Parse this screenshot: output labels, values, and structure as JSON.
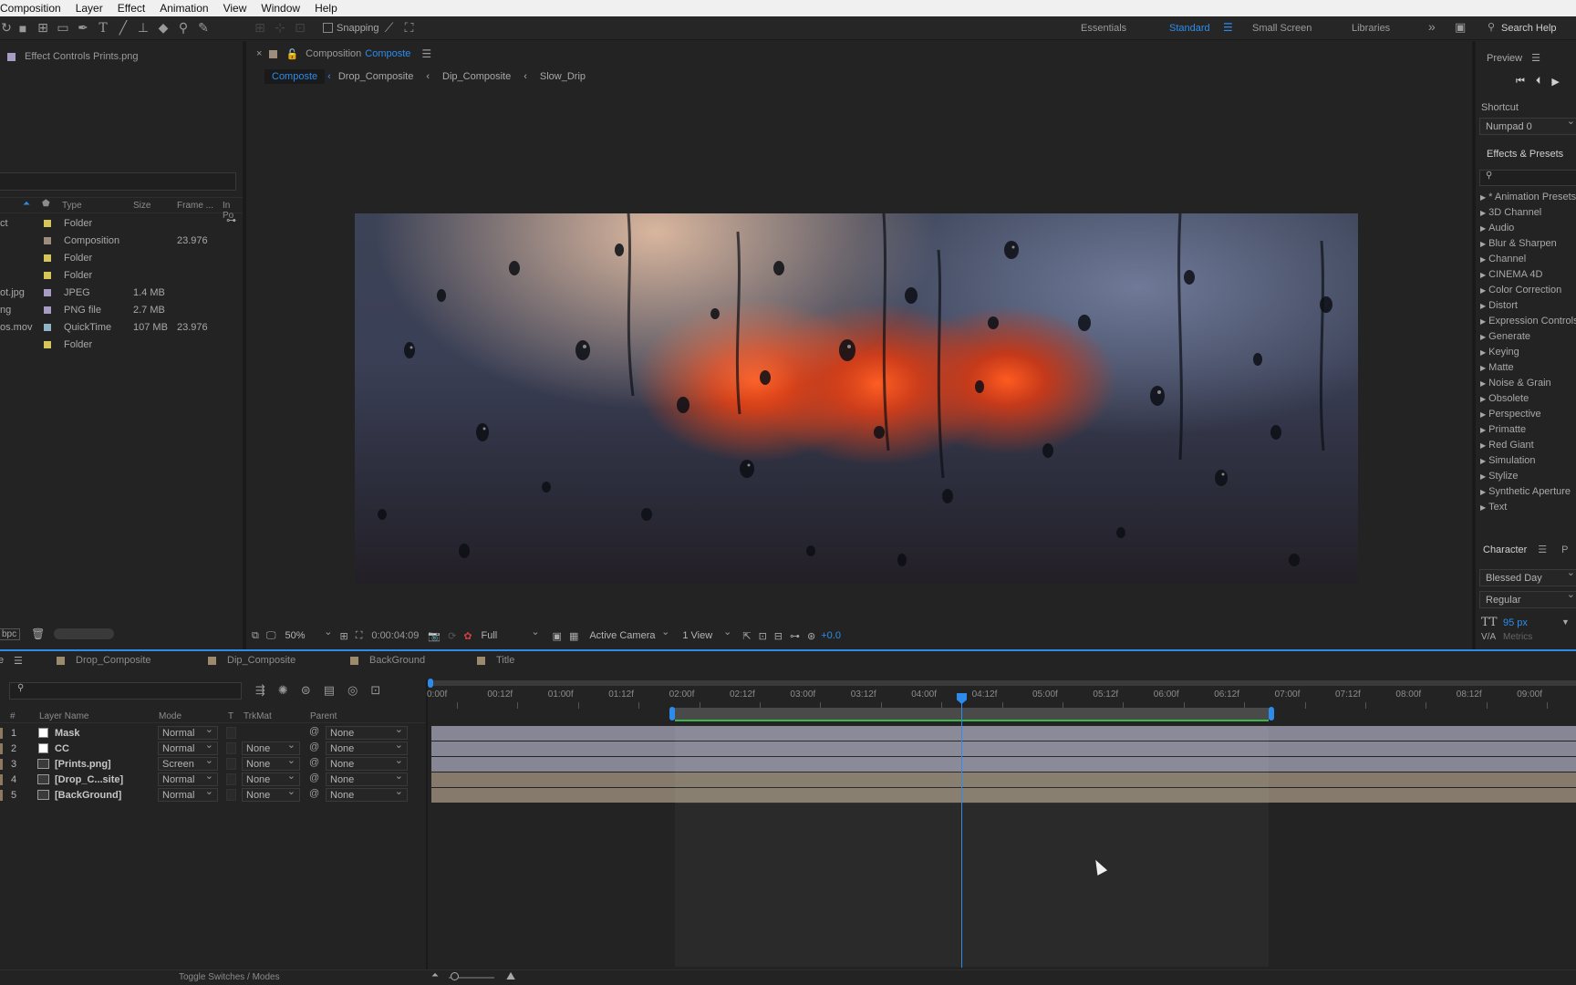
{
  "menu": [
    "Composition",
    "Layer",
    "Effect",
    "Animation",
    "View",
    "Window",
    "Help"
  ],
  "toolbar": {
    "snapping": "Snapping",
    "workspaces": [
      "Essentials",
      "Standard",
      "Small Screen",
      "Libraries"
    ],
    "search": "Search Help"
  },
  "effect_controls": {
    "title": "Effect Controls Prints.png"
  },
  "project": {
    "columns": [
      "Type",
      "Size",
      "Frame ...",
      "In Po"
    ],
    "rows": [
      {
        "name": "ct",
        "type": "Folder",
        "size": "",
        "fr": "",
        "color": "#d8c55a"
      },
      {
        "name": "",
        "type": "Composition",
        "size": "",
        "fr": "23.976",
        "color": "#9d8d7c"
      },
      {
        "name": "",
        "type": "Folder",
        "size": "",
        "fr": "",
        "color": "#d8c55a"
      },
      {
        "name": "",
        "type": "Folder",
        "size": "",
        "fr": "",
        "color": "#d8c55a"
      },
      {
        "name": "ot.jpg",
        "type": "JPEG",
        "size": "1.4 MB",
        "fr": "",
        "color": "#a79cc4"
      },
      {
        "name": "ng",
        "type": "PNG file",
        "size": "2.7 MB",
        "fr": "",
        "color": "#a79cc4"
      },
      {
        "name": "os.mov",
        "type": "QuickTime",
        "size": "107 MB",
        "fr": "23.976",
        "color": "#8fb5c6"
      },
      {
        "name": "",
        "type": "Folder",
        "size": "",
        "fr": "",
        "color": "#d8c55a"
      }
    ],
    "bpc": "bpc"
  },
  "comp": {
    "label": "Composition",
    "name": "Composte",
    "breadcrumbs": [
      "Composte",
      "Drop_Composite",
      "Dip_Composite",
      "Slow_Drip"
    ],
    "zoom": "50%",
    "timecode": "0:00:04:09",
    "quality": "Full",
    "camera": "Active Camera",
    "views": "1 View",
    "exposure": "+0.0"
  },
  "right": {
    "preview": "Preview",
    "shortcut_label": "Shortcut",
    "shortcut_value": "Numpad 0",
    "effects_title": "Effects & Presets",
    "effects": [
      "* Animation Presets",
      "3D Channel",
      "Audio",
      "Blur & Sharpen",
      "Channel",
      "CINEMA 4D",
      "Color Correction",
      "Distort",
      "Expression Controls",
      "Generate",
      "Keying",
      "Matte",
      "Noise & Grain",
      "Obsolete",
      "Perspective",
      "Primatte",
      "Red Giant",
      "Simulation",
      "Stylize",
      "Synthetic Aperture",
      "Text"
    ],
    "character": "Character",
    "font": "Blessed Day",
    "style": "Regular",
    "size": "95 px",
    "tracking": "Metrics"
  },
  "timeline": {
    "tabs": [
      "Drop_Composite",
      "Dip_Composite",
      "BackGround",
      "Title"
    ],
    "ruler": [
      "0:00f",
      "00:12f",
      "01:00f",
      "01:12f",
      "02:00f",
      "02:12f",
      "03:00f",
      "03:12f",
      "04:00f",
      "04:12f",
      "05:00f",
      "05:12f",
      "06:00f",
      "06:12f",
      "07:00f",
      "07:12f",
      "08:00f",
      "08:12f",
      "09:00f",
      "09"
    ],
    "cols": {
      "num": "#",
      "name": "Layer Name",
      "mode": "Mode",
      "t": "T",
      "trkmat": "TrkMat",
      "parent": "Parent"
    },
    "layers": [
      {
        "n": "1",
        "name": "Mask",
        "mode": "Normal",
        "trk": "",
        "parent": "None"
      },
      {
        "n": "2",
        "name": "CC",
        "mode": "Normal",
        "trk": "None",
        "parent": "None"
      },
      {
        "n": "3",
        "name": "[Prints.png]",
        "mode": "Screen",
        "trk": "None",
        "parent": "None"
      },
      {
        "n": "4",
        "name": "[Drop_C...site]",
        "mode": "Normal",
        "trk": "None",
        "parent": "None"
      },
      {
        "n": "5",
        "name": "[BackGround]",
        "mode": "Normal",
        "trk": "None",
        "parent": "None"
      }
    ],
    "toggle": "Toggle Switches / Modes"
  }
}
